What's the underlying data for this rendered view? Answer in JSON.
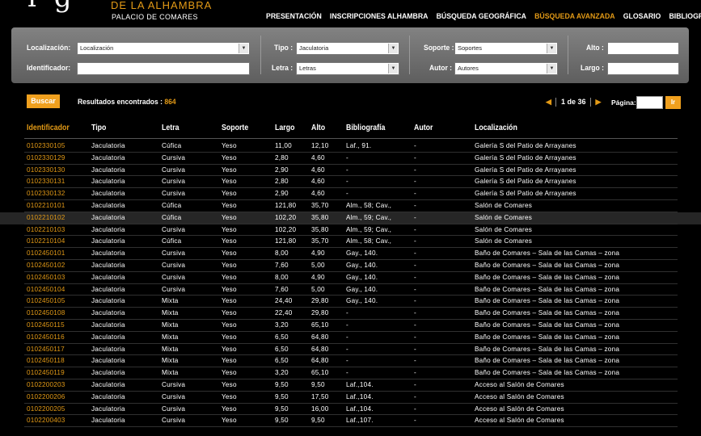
{
  "header": {
    "logo_glyph": "ig",
    "logo_line1": "DE LA ALHAMBRA",
    "logo_line2": "PALACIO DE COMARES",
    "nav": [
      {
        "label": "PRESENTACIÓN",
        "active": false
      },
      {
        "label": "INSCRIPCIONES ALHAMBRA",
        "active": false
      },
      {
        "label": "BÚSQUEDA GEOGRÁFICA",
        "active": false
      },
      {
        "label": "BÚSQUEDA AVANZADA",
        "active": true
      },
      {
        "label": "GLOSARIO",
        "active": false
      },
      {
        "label": "BIBLIOGRAFÍA",
        "active": false
      }
    ]
  },
  "search": {
    "localizacion_label": "Localización:",
    "localizacion_value": "Localización",
    "identificador_label": "Identificador:",
    "identificador_value": "",
    "tipo_label": "Tipo :",
    "tipo_value": "Jaculatoria",
    "letra_label": "Letra :",
    "letra_value": "Letras",
    "soporte_label": "Soporte :",
    "soporte_value": "Soportes",
    "autor_label": "Autor :",
    "autor_value": "Autores",
    "alto_label": "Alto :",
    "alto_value": "",
    "largo_label": "Largo :",
    "largo_value": ""
  },
  "results": {
    "buscar_label": "Buscar",
    "label": "Resultados encontrados :",
    "count": "864",
    "page_text": "1 de 36",
    "prev_icon": "◀",
    "next_icon": "▶",
    "pagina_label": "Página:",
    "ir_label": "Ir"
  },
  "table": {
    "headers": [
      "Identificador",
      "Tipo",
      "Letra",
      "Soporte",
      "Largo",
      "Alto",
      "Bibliografía",
      "Autor",
      "Localización"
    ],
    "rows": [
      [
        "0102330105",
        "Jaculatoria",
        "Cúfica",
        "Yeso",
        "11,00",
        "12,10",
        "Laf., 91.",
        "-",
        "Galería S del Patio de Arrayanes"
      ],
      [
        "0102330129",
        "Jaculatoria",
        "Cursiva",
        "Yeso",
        "2,80",
        "4,60",
        "-",
        "-",
        "Galería S del Patio de Arrayanes"
      ],
      [
        "0102330130",
        "Jaculatoria",
        "Cursiva",
        "Yeso",
        "2,90",
        "4,60",
        "-",
        "-",
        "Galería S del Patio de Arrayanes"
      ],
      [
        "0102330131",
        "Jaculatoria",
        "Cursiva",
        "Yeso",
        "2,80",
        "4,60",
        "-",
        "-",
        "Galería S del Patio de Arrayanes"
      ],
      [
        "0102330132",
        "Jaculatoria",
        "Cursiva",
        "Yeso",
        "2,90",
        "4,60",
        "-",
        "-",
        "Galería S del Patio de Arrayanes"
      ],
      [
        "0102210101",
        "Jaculatoria",
        "Cúfica",
        "Yeso",
        "121,80",
        "35,70",
        "Alm., 58; Cav.,",
        "-",
        "Salón de Comares"
      ],
      [
        "0102210102",
        "Jaculatoria",
        "Cúfica",
        "Yeso",
        "102,20",
        "35,80",
        "Alm., 59; Cav.,",
        "-",
        "Salón de Comares"
      ],
      [
        "0102210103",
        "Jaculatoria",
        "Cursiva",
        "Yeso",
        "102,20",
        "35,80",
        "Alm., 59; Cav.,",
        "-",
        "Salón de Comares"
      ],
      [
        "0102210104",
        "Jaculatoria",
        "Cúfica",
        "Yeso",
        "121,80",
        "35,70",
        "Alm., 58; Cav.,",
        "-",
        "Salón de Comares"
      ],
      [
        "0102450101",
        "Jaculatoria",
        "Cursiva",
        "Yeso",
        "8,00",
        "4,90",
        "Gay., 140.",
        "-",
        "Baño de Comares – Sala de las Camas – zona"
      ],
      [
        "0102450102",
        "Jaculatoria",
        "Cursiva",
        "Yeso",
        "7,60",
        "5,00",
        "Gay., 140.",
        "-",
        "Baño de Comares – Sala de las Camas – zona"
      ],
      [
        "0102450103",
        "Jaculatoria",
        "Cursiva",
        "Yeso",
        "8,00",
        "4,90",
        "Gay., 140.",
        "-",
        "Baño de Comares – Sala de las Camas – zona"
      ],
      [
        "0102450104",
        "Jaculatoria",
        "Cursiva",
        "Yeso",
        "7,60",
        "5,00",
        "Gay., 140.",
        "-",
        "Baño de Comares – Sala de las Camas – zona"
      ],
      [
        "0102450105",
        "Jaculatoria",
        "Mixta",
        "Yeso",
        "24,40",
        "29,80",
        "Gay., 140.",
        "-",
        "Baño de Comares – Sala de las Camas – zona"
      ],
      [
        "0102450108",
        "Jaculatoria",
        "Mixta",
        "Yeso",
        "22,40",
        "29,80",
        "-",
        "-",
        "Baño de Comares – Sala de las Camas – zona"
      ],
      [
        "0102450115",
        "Jaculatoria",
        "Mixta",
        "Yeso",
        "3,20",
        "65,10",
        "-",
        "-",
        "Baño de Comares – Sala de las Camas – zona"
      ],
      [
        "0102450116",
        "Jaculatoria",
        "Mixta",
        "Yeso",
        "6,50",
        "64,80",
        "-",
        "-",
        "Baño de Comares – Sala de las Camas – zona"
      ],
      [
        "0102450117",
        "Jaculatoria",
        "Mixta",
        "Yeso",
        "6,50",
        "64,80",
        "-",
        "-",
        "Baño de Comares – Sala de las Camas – zona"
      ],
      [
        "0102450118",
        "Jaculatoria",
        "Mixta",
        "Yeso",
        "6,50",
        "64,80",
        "-",
        "-",
        "Baño de Comares – Sala de las Camas – zona"
      ],
      [
        "0102450119",
        "Jaculatoria",
        "Mixta",
        "Yeso",
        "3,20",
        "65,10",
        "-",
        "-",
        "Baño de Comares – Sala de las Camas – zona"
      ],
      [
        "0102200203",
        "Jaculatoria",
        "Cursiva",
        "Yeso",
        "9,50",
        "9,50",
        "Laf.,104.",
        "-",
        "Acceso al Salón de Comares"
      ],
      [
        "0102200206",
        "Jaculatoria",
        "Cursiva",
        "Yeso",
        "9,50",
        "17,50",
        "Laf.,104.",
        "-",
        "Acceso al Salón de Comares"
      ],
      [
        "0102200205",
        "Jaculatoria",
        "Cursiva",
        "Yeso",
        "9,50",
        "16,00",
        "Laf.,104.",
        "-",
        "Acceso al Salón de Comares"
      ],
      [
        "0102200403",
        "Jaculatoria",
        "Cursiva",
        "Yeso",
        "9,50",
        "9,50",
        "Laf.,107.",
        "-",
        "Acceso al Salón de Comares"
      ]
    ],
    "highlighted_row": 6
  },
  "colors": {
    "accent": "#e39a16",
    "panel": "#6e6e6e",
    "background": "#000000"
  }
}
